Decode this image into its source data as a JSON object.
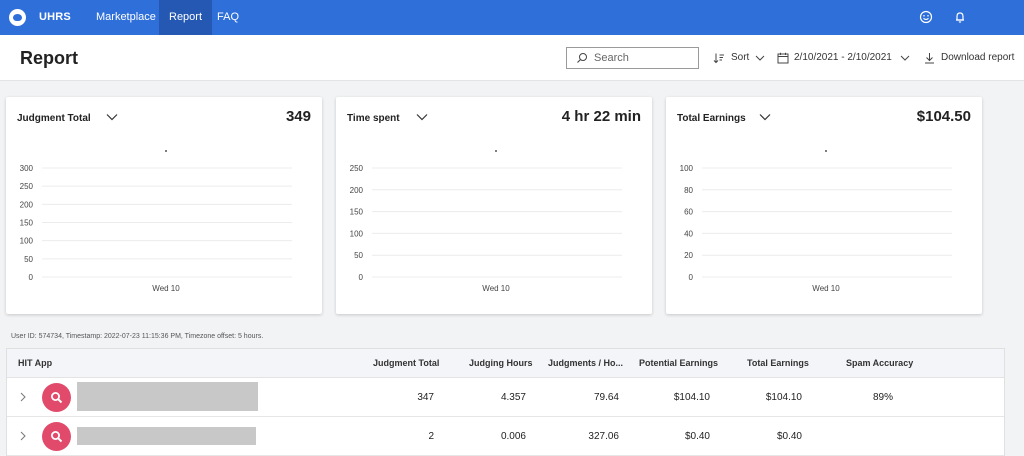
{
  "nav": {
    "brand": "UHRS",
    "items": [
      "Marketplace",
      "Report",
      "FAQ"
    ],
    "active": "Report"
  },
  "header": {
    "title": "Report",
    "search_placeholder": "Search",
    "sort_label": "Sort",
    "date_range": "2/10/2021 - 2/10/2021",
    "download_label": "Download report"
  },
  "cards": [
    {
      "label": "Judgment Total",
      "value": "349",
      "ticks": [
        "300",
        "250",
        "200",
        "150",
        "100",
        "50",
        "0"
      ],
      "x_label": "Wed 10"
    },
    {
      "label": "Time spent",
      "value": "4 hr 22 min",
      "ticks": [
        "250",
        "200",
        "150",
        "100",
        "50",
        "0"
      ],
      "x_label": "Wed 10"
    },
    {
      "label": "Total Earnings",
      "value": "$104.50",
      "ticks": [
        "100",
        "80",
        "60",
        "40",
        "20",
        "0"
      ],
      "x_label": "Wed 10"
    }
  ],
  "meta_text": "User ID: 574734,  Timestamp: 2022-07-23 11:15:36 PM, Timezone offset: 5 hours.",
  "table": {
    "columns": [
      "HIT App",
      "Judgment Total",
      "Judging Hours",
      "Judgments / Ho...",
      "Potential Earnings",
      "Total Earnings",
      "Spam Accuracy"
    ],
    "rows": [
      {
        "judgment_total": "347",
        "judging_hours": "4.357",
        "judgments_per_hour": "79.64",
        "potential_earnings": "$104.10",
        "total_earnings": "$104.10",
        "spam_accuracy": "89%"
      },
      {
        "judgment_total": "2",
        "judging_hours": "0.006",
        "judgments_per_hour": "327.06",
        "potential_earnings": "$0.40",
        "total_earnings": "$0.40",
        "spam_accuracy": ""
      }
    ]
  },
  "colors": {
    "nav_bg": "#2f6fd9",
    "nav_active": "#2458b3",
    "app_icon": "#e24a6b"
  },
  "icons": [
    "app-logo-icon",
    "smiley-icon",
    "bell-icon",
    "search-icon",
    "sort-icon",
    "calendar-icon",
    "chevron-down-icon",
    "download-icon",
    "expand-chevron-icon",
    "app-search-icon"
  ]
}
